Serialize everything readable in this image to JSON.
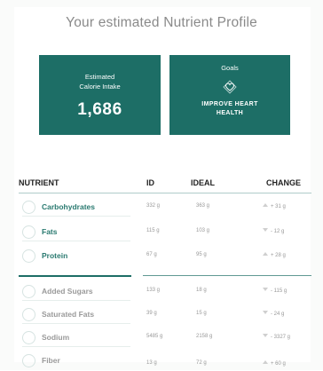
{
  "title": "Your estimated Nutrient Profile",
  "calorie": {
    "label_line1": "Estimated",
    "label_line2": "Calorie Intake",
    "value": "1,686"
  },
  "goals": {
    "label": "Goals",
    "icon": "heart-icon",
    "value_line1": "IMPROVE HEART",
    "value_line2": "HEALTH"
  },
  "table": {
    "headers": {
      "nutrient": "NUTRIENT",
      "id": "ID",
      "ideal": "IDEAL",
      "change": "CHANGE"
    },
    "group1": [
      {
        "name": "Carbohydrates",
        "id": "332 g",
        "ideal": "363 g",
        "direction": "up",
        "change": "+ 31 g"
      },
      {
        "name": "Fats",
        "id": "115 g",
        "ideal": "103 g",
        "direction": "down",
        "change": "- 12 g"
      },
      {
        "name": "Protein",
        "id": "67 g",
        "ideal": "95 g",
        "direction": "up",
        "change": "+ 28 g"
      }
    ],
    "group2": [
      {
        "name": "Added Sugars",
        "id": "133 g",
        "ideal": "18 g",
        "direction": "down",
        "change": "- 115 g"
      },
      {
        "name": "Saturated Fats",
        "id": "39 g",
        "ideal": "15 g",
        "direction": "down",
        "change": "- 24 g"
      },
      {
        "name": "Sodium",
        "id": "5485 g",
        "ideal": "2158 g",
        "direction": "down",
        "change": "- 3327 g"
      },
      {
        "name": "Fiber",
        "id": "13 g",
        "ideal": "72 g",
        "direction": "up",
        "change": "+ 60 g"
      }
    ]
  },
  "colors": {
    "accent": "#1d6e66",
    "nutrient_text": "#2a7a70",
    "muted": "#999999"
  }
}
